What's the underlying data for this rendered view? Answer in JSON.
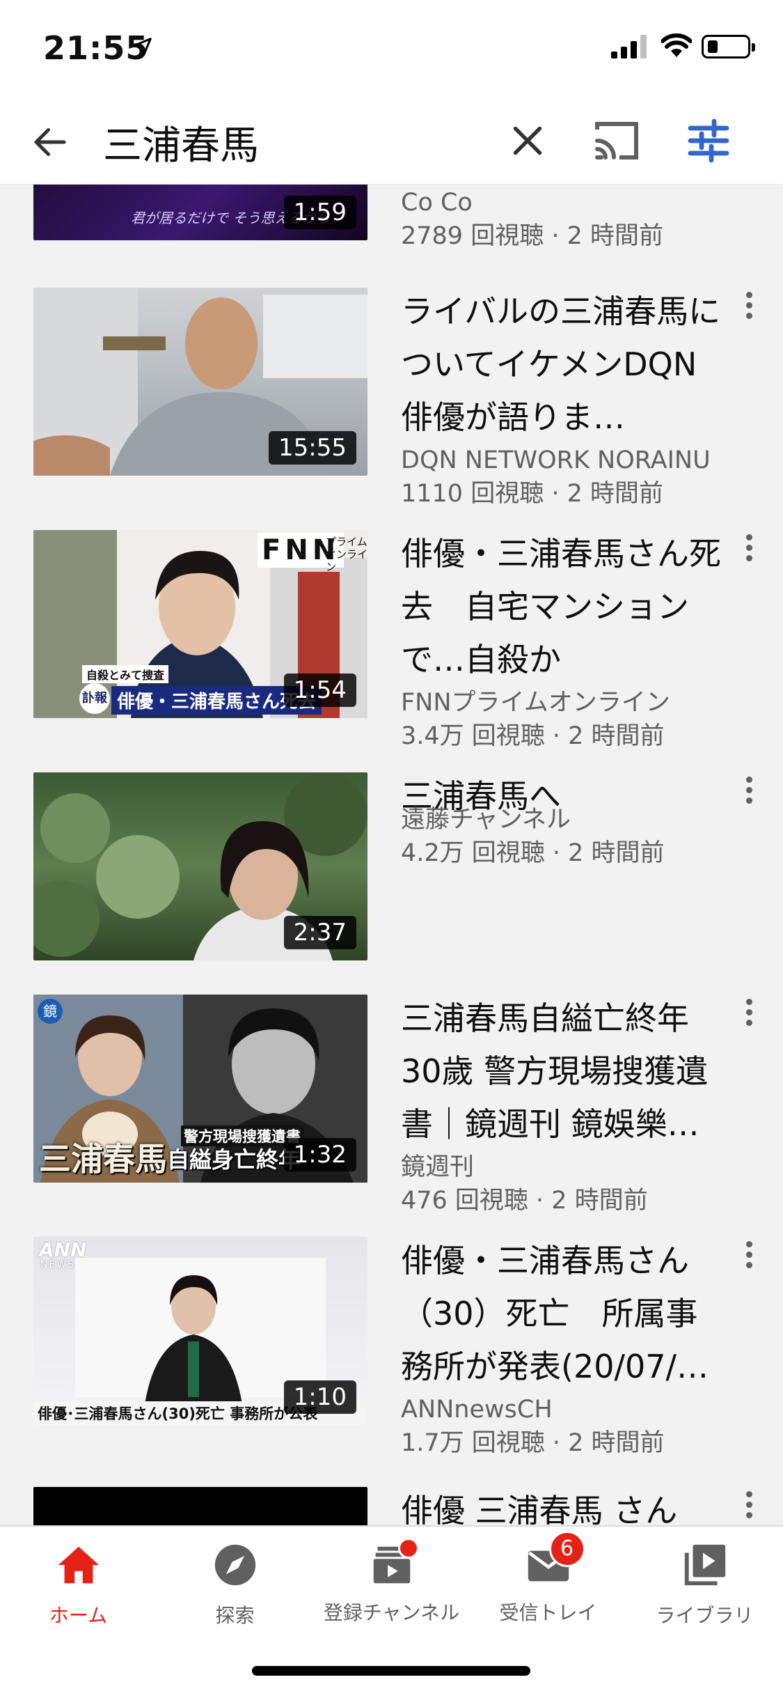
{
  "status": {
    "time": "21:55"
  },
  "search": {
    "query": "三浦春馬"
  },
  "colors": {
    "accent_red": "#e62117",
    "filter_blue": "#3366cc",
    "list_bg": "#f2f2f2"
  },
  "videos": [
    {
      "title": "",
      "channel": "Co Co",
      "views": "2789 回視聴 · 2 時間前",
      "duration": "1:59",
      "thumb_caption": "君が居るだけで そう思えるから"
    },
    {
      "title": "ライバルの三浦春馬についてイケメンDQN俳優が語りま…",
      "channel": "DQN NETWORK NORAINU",
      "views": "1110 回視聴 · 2 時間前",
      "duration": "15:55"
    },
    {
      "title": "俳優・三浦春馬さん死去　自宅マンションで…自殺か",
      "channel": "FNNプライムオンライン",
      "views": "3.4万 回視聴 · 2 時間前",
      "duration": "1:54",
      "thumb_logo": "FNN",
      "thumb_logo_sub": "プライム オンライン",
      "thumb_tag": "自殺とみて捜査",
      "thumb_flag": "訃報",
      "thumb_banner": "俳優・三浦春馬さん死去"
    },
    {
      "title": "三浦春馬へ",
      "channel": "遠藤チャンネル",
      "views": "4.2万 回視聴 · 2 時間前",
      "duration": "2:37"
    },
    {
      "title": "三浦春馬自縊亡終年30歲 警方現場搜獲遺書｜鏡週刊 鏡娛樂…",
      "channel": "鏡週刊",
      "views": "476 回視聴 · 2 時間前",
      "duration": "1:32",
      "thumb_name": "三浦春馬",
      "thumb_sub1": "警方現場搜獲遺書",
      "thumb_sub2": "自縊身亡終年"
    },
    {
      "title": "俳優・三浦春馬さん（30）死亡　所属事務所が発表(20/07/…",
      "channel": "ANNnewsCH",
      "views": "1.7万 回視聴 · 2 時間前",
      "duration": "1:10",
      "thumb_logo": "ANN",
      "thumb_logo_sub": "NEWS",
      "thumb_banner": "俳優･三浦春馬さん(30)死亡 事務所が公表"
    },
    {
      "title": "俳優 三浦春馬 さん",
      "channel": "",
      "views": "",
      "duration": ""
    }
  ],
  "nav": [
    {
      "label": "ホーム",
      "icon": "home-icon"
    },
    {
      "label": "探索",
      "icon": "explore-icon"
    },
    {
      "label": "登録チャンネル",
      "icon": "subscriptions-icon"
    },
    {
      "label": "受信トレイ",
      "icon": "inbox-icon",
      "badge": "6"
    },
    {
      "label": "ライブラリ",
      "icon": "library-icon"
    }
  ]
}
